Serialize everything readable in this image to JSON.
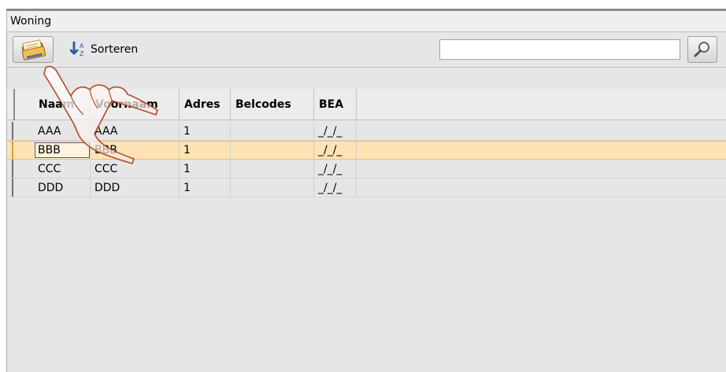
{
  "window": {
    "title": "Woning"
  },
  "toolbar": {
    "open_icon": "folder-icon",
    "sort_label": "Sorteren",
    "sort_icon": "sort-az-icon",
    "search_value": "",
    "search_icon": "magnifier-icon"
  },
  "grid": {
    "columns": [
      "Naam",
      "Voornaam",
      "Adres",
      "Belcodes",
      "BEA"
    ],
    "rows": [
      {
        "naam": "AAA",
        "voornaam": "AAA",
        "adres": "1",
        "belcodes": "",
        "bea": "_/_/_"
      },
      {
        "naam": "BBB",
        "voornaam": "BBB",
        "adres": "1",
        "belcodes": "",
        "bea": "_/_/_"
      },
      {
        "naam": "CCC",
        "voornaam": "CCC",
        "adres": "1",
        "belcodes": "",
        "bea": "_/_/_"
      },
      {
        "naam": "DDD",
        "voornaam": "DDD",
        "adres": "1",
        "belcodes": "",
        "bea": "_/_/_"
      }
    ],
    "selected_row": 1
  },
  "overlay": {
    "pointer_icon": "hand-pointer-icon"
  },
  "colors": {
    "selected_row": "#fde3b6",
    "background": "#e6e6e6"
  }
}
